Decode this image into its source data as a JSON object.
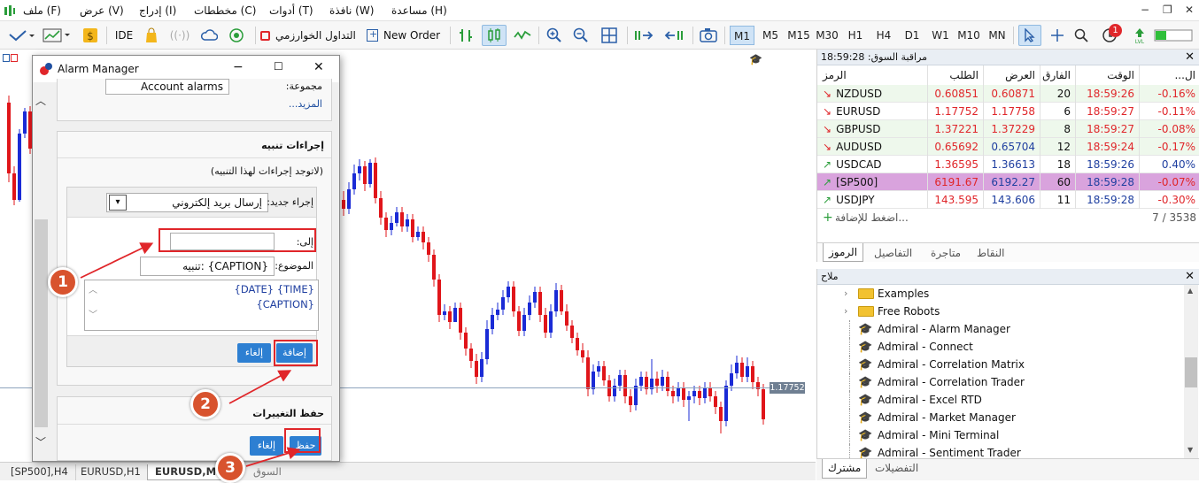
{
  "menu": {
    "items": [
      "ملف (F)",
      "عرض (V)",
      "إدراج (I)",
      "مخططات (C)",
      "أدوات (T)",
      "نافذة (W)",
      "مساعدة (H)"
    ]
  },
  "toolbar": {
    "ide": "IDE",
    "algo_trading": "التداول الخوارزمي",
    "new_order": "New Order",
    "timeframes": [
      "M1",
      "M5",
      "M15",
      "M30",
      "H1",
      "H4",
      "D1",
      "W1",
      "M10",
      "MN"
    ],
    "notification_count": "1"
  },
  "chart": {
    "price_label": "1.17752"
  },
  "chart_tabs": [
    "[SP500],H4",
    "EURUSD,H1",
    "EURUSD,M1",
    "السوق"
  ],
  "market_watch": {
    "title": "مراقبة السوق: 18:59:28",
    "columns": {
      "symbol": "الرمز",
      "bid": "الطلب",
      "ask": "العرض",
      "spread": "الفارق",
      "time": "الوقت",
      "change": "...ال"
    },
    "rows": [
      {
        "symbol": "NZDUSD",
        "bid": "0.60851",
        "ask": "0.60871",
        "spread": "20",
        "time": "18:59:26",
        "change": "-0.16%",
        "dir": "down"
      },
      {
        "symbol": "EURUSD",
        "bid": "1.17752",
        "ask": "1.17758",
        "spread": "6",
        "time": "18:59:27",
        "change": "-0.11%",
        "dir": "down"
      },
      {
        "symbol": "GBPUSD",
        "bid": "1.37221",
        "ask": "1.37229",
        "spread": "8",
        "time": "18:59:27",
        "change": "-0.08%",
        "dir": "down"
      },
      {
        "symbol": "AUDUSD",
        "bid": "0.65692",
        "ask": "0.65704",
        "spread": "12",
        "time": "18:59:24",
        "change": "-0.17%",
        "dir": "down"
      },
      {
        "symbol": "USDCAD",
        "bid": "1.36595",
        "ask": "1.36613",
        "spread": "18",
        "time": "18:59:26",
        "change": "0.40%",
        "dir": "up"
      },
      {
        "symbol": "[SP500]",
        "bid": "6191.67",
        "ask": "6192.27",
        "spread": "60",
        "time": "18:59:28",
        "change": "-0.07%",
        "dir": "up"
      },
      {
        "symbol": "USDJPY",
        "bid": "143.595",
        "ask": "143.606",
        "spread": "11",
        "time": "18:59:28",
        "change": "-0.30%",
        "dir": "up"
      }
    ],
    "add_text": "اضغط للإضافة...",
    "count": "7 / 3538",
    "tabs": [
      "الرموز",
      "التفاصيل",
      "متاجرة",
      "النقاط"
    ]
  },
  "navigator": {
    "title": "ملاح",
    "items": [
      {
        "label": "Examples",
        "type": "folder"
      },
      {
        "label": "Free Robots",
        "type": "folder"
      },
      {
        "label": "Admiral - Alarm Manager",
        "type": "app"
      },
      {
        "label": "Admiral - Connect",
        "type": "app"
      },
      {
        "label": "Admiral - Correlation Matrix",
        "type": "app"
      },
      {
        "label": "Admiral - Correlation Trader",
        "type": "app"
      },
      {
        "label": "Admiral - Excel RTD",
        "type": "app"
      },
      {
        "label": "Admiral - Market Manager",
        "type": "app"
      },
      {
        "label": "Admiral - Mini Terminal",
        "type": "app"
      },
      {
        "label": "Admiral - Sentiment Trader",
        "type": "app"
      }
    ],
    "tabs": [
      "مشترك",
      "التفضيلات"
    ]
  },
  "dialog": {
    "title": "Alarm Manager",
    "group_label": "مجموعة:",
    "group_value": "Account alarms",
    "more_link": "المزيد...",
    "actions_title": "إجراءات تنبيه",
    "no_actions": "(لاتوجد إجراءات لهذا التنبيه)",
    "new_action_label": "إجراء جديد:",
    "new_action_value": "إرسال بريد إلكتروني",
    "to_label": "إلى:",
    "to_value": "",
    "subject_label": "الموضوع:",
    "subject_value": "تنبيه: {CAPTION}",
    "body_line1": "{DATE} {TIME}",
    "body_line2": "{CAPTION}",
    "add_button": "إضافة",
    "cancel_button": "إلغاء",
    "save_title": "حفظ التغييرات",
    "save_button": "حفظ",
    "save_cancel_button": "إلغاء"
  },
  "callouts": [
    "1",
    "2",
    "3"
  ],
  "colors": {
    "accent": "#2d7fd2",
    "callout": "#d8532e",
    "highlight": "#e0262a",
    "bull": "#1a2bd6",
    "bear": "#e0151a"
  }
}
